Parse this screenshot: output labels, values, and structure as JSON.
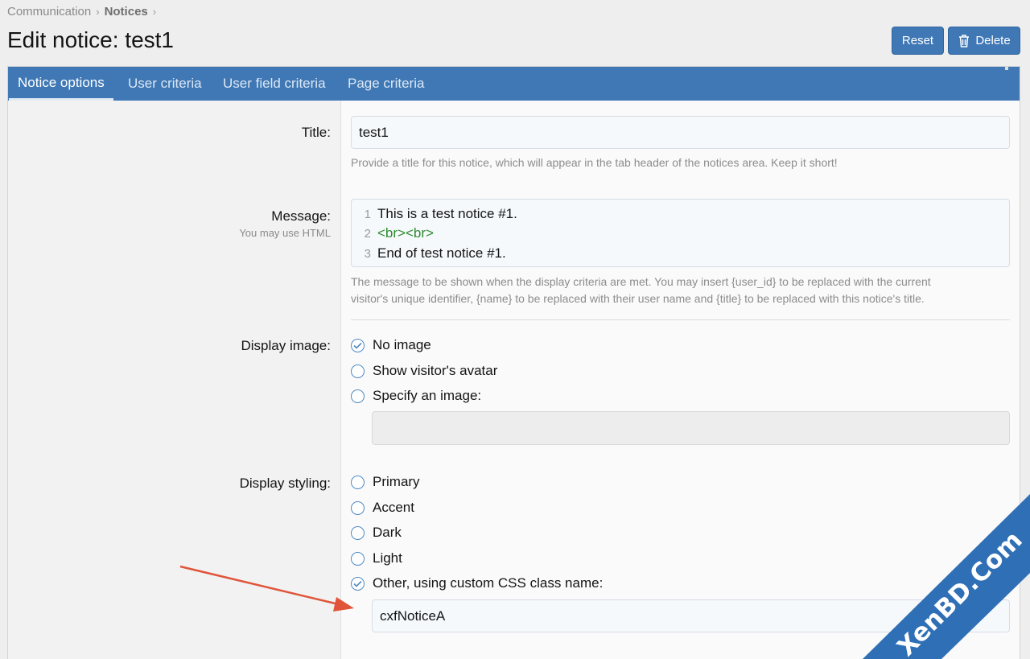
{
  "breadcrumb": {
    "items": [
      "Communication",
      "Notices"
    ]
  },
  "page": {
    "title": "Edit notice: test1"
  },
  "buttons": {
    "reset": "Reset",
    "delete": "Delete"
  },
  "tabs": [
    {
      "label": "Notice options",
      "active": true
    },
    {
      "label": "User criteria",
      "active": false
    },
    {
      "label": "User field criteria",
      "active": false
    },
    {
      "label": "Page criteria",
      "active": false
    }
  ],
  "form": {
    "title": {
      "label": "Title:",
      "value": "test1",
      "help": "Provide a title for this notice, which will appear in the tab header of the notices area. Keep it short!"
    },
    "message": {
      "label": "Message:",
      "hint": "You may use HTML",
      "lines": [
        {
          "number": "1",
          "text": "This is a test notice #1."
        },
        {
          "number": "2",
          "text": "<br><br>"
        },
        {
          "number": "3",
          "text": "End of test notice #1."
        }
      ],
      "help_line1": "The message to be shown when the display criteria are met. You may insert {user_id} to be replaced with the current",
      "help_line2": "visitor's unique identifier, {name} to be replaced with their user name and {title} to be replaced with this notice's title."
    },
    "display_image": {
      "label": "Display image:",
      "options": [
        {
          "label": "No image",
          "selected": true
        },
        {
          "label": "Show visitor's avatar",
          "selected": false
        },
        {
          "label": "Specify an image:",
          "selected": false
        }
      ],
      "image_value": ""
    },
    "display_styling": {
      "label": "Display styling:",
      "options": [
        {
          "label": "Primary",
          "selected": false
        },
        {
          "label": "Accent",
          "selected": false
        },
        {
          "label": "Dark",
          "selected": false
        },
        {
          "label": "Light",
          "selected": false
        },
        {
          "label": "Other, using custom CSS class name:",
          "selected": true
        }
      ],
      "custom_class": "cxfNoticeA"
    }
  },
  "watermark": {
    "text": "XenBD.Com"
  },
  "colors": {
    "accent": "#3f78b5",
    "arrow": "#e0553a",
    "code_tag": "#2f8a2f"
  }
}
